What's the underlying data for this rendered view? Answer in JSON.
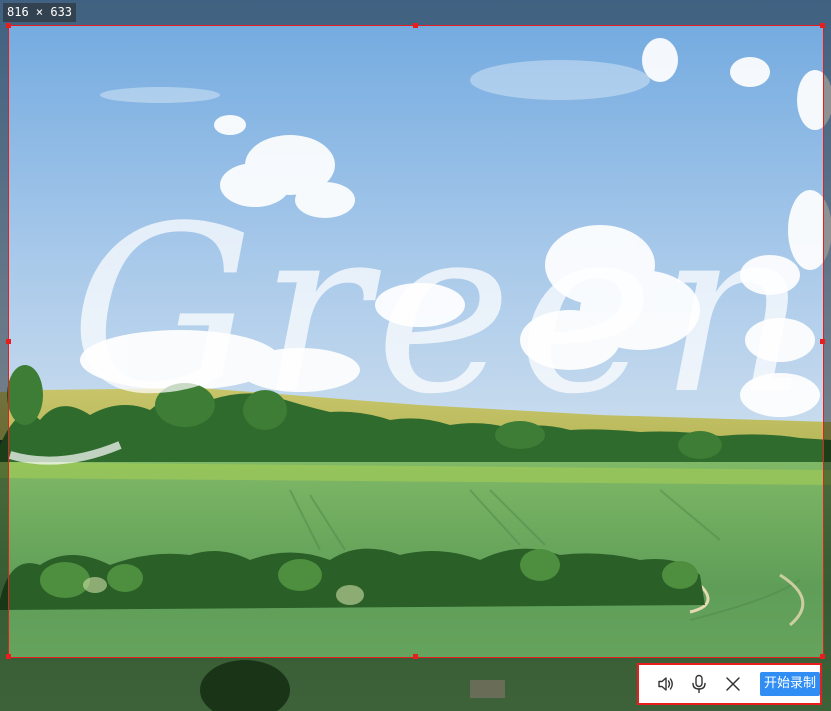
{
  "selection": {
    "size_text": "816 × 633"
  },
  "background_image": {
    "overlay_text": "Green"
  },
  "toolbar": {
    "icons": {
      "speaker": "speaker-icon",
      "microphone": "microphone-icon",
      "close": "close-icon"
    },
    "record_label": "开始录制"
  },
  "colors": {
    "selection_border": "#e81d1d",
    "record_button": "#2f8df4",
    "sky_top": "#7fb2e3",
    "field_green": "#5c9f56"
  }
}
